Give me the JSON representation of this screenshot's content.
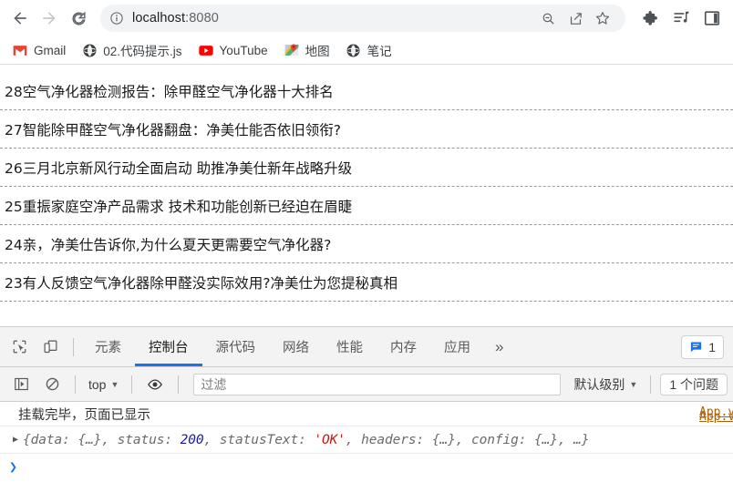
{
  "browser": {
    "nav": {
      "back_title": "后退",
      "forward_title": "前进",
      "reload_title": "重新加载"
    },
    "omnibox": {
      "url_host": "localhost",
      "url_port": ":8080",
      "info_icon": "info-circle-icon",
      "zoom_icon": "zoom-out-icon",
      "share_icon": "share-icon",
      "bookmark_icon": "star-icon"
    },
    "extensions": [
      {
        "name": "extensions-puzzle-icon"
      },
      {
        "name": "reading-list-icon"
      },
      {
        "name": "side-panel-icon"
      }
    ],
    "bookmarks": [
      {
        "label": "Gmail",
        "icon": "gmail-icon"
      },
      {
        "label": "02.代码提示.js",
        "icon": "globe-icon"
      },
      {
        "label": "YouTube",
        "icon": "youtube-icon"
      },
      {
        "label": "地图",
        "icon": "maps-icon"
      },
      {
        "label": "笔记",
        "icon": "globe-icon"
      }
    ]
  },
  "page": {
    "news_items": [
      "28空气净化器检测报告：除甲醛空气净化器十大排名",
      "27智能除甲醛空气净化器翻盘：净美仕能否依旧领衔?",
      "26三月北京新风行动全面启动 助推净美仕新年战略升级",
      "25重振家庭空净产品需求 技术和功能创新已经迫在眉睫",
      "24亲，净美仕告诉你,为什么夏天更需要空气净化器?",
      "23有人反馈空气净化器除甲醛没实际效用?净美仕为您提秘真相"
    ]
  },
  "devtools": {
    "toolbar_icons": [
      {
        "name": "inspect-element-icon"
      },
      {
        "name": "device-toolbar-icon"
      }
    ],
    "tabs": [
      {
        "label": "元素",
        "active": false
      },
      {
        "label": "控制台",
        "active": true
      },
      {
        "label": "源代码",
        "active": false
      },
      {
        "label": "网络",
        "active": false
      },
      {
        "label": "性能",
        "active": false
      },
      {
        "label": "内存",
        "active": false
      },
      {
        "label": "应用",
        "active": false
      }
    ],
    "more_tabs_label": "»",
    "message_badge": {
      "icon": "message-bubble-icon",
      "count": "1"
    },
    "console_toolbar": {
      "sidebar_icon": "console-sidebar-icon",
      "clear_icon": "clear-console-icon",
      "context": "top",
      "eye_icon": "live-expression-icon",
      "filter_placeholder": "过滤",
      "filter_value": "",
      "level": "默认级别",
      "issues": "1 个问题"
    },
    "console_rows": [
      {
        "type": "log",
        "message": "挂载完毕，页面已显示",
        "source": "App.vu"
      },
      {
        "type": "object",
        "source": "App.vu",
        "tokens": [
          {
            "t": "{data: {…}, status: ",
            "k": "plain"
          },
          {
            "t": "200",
            "k": "number"
          },
          {
            "t": ", statusText: ",
            "k": "plain"
          },
          {
            "t": "'OK'",
            "k": "string"
          },
          {
            "t": ", headers: {…}, config: {…}, …}",
            "k": "plain"
          }
        ]
      }
    ],
    "prompt_caret": "❯"
  },
  "colors": {
    "accent": "#1a73e8",
    "omnibox_bg": "#f1f3f4",
    "devtools_bg": "#f3f3f3",
    "link": "#b06000",
    "number": "#1a1aa6",
    "string": "#c41a16"
  }
}
